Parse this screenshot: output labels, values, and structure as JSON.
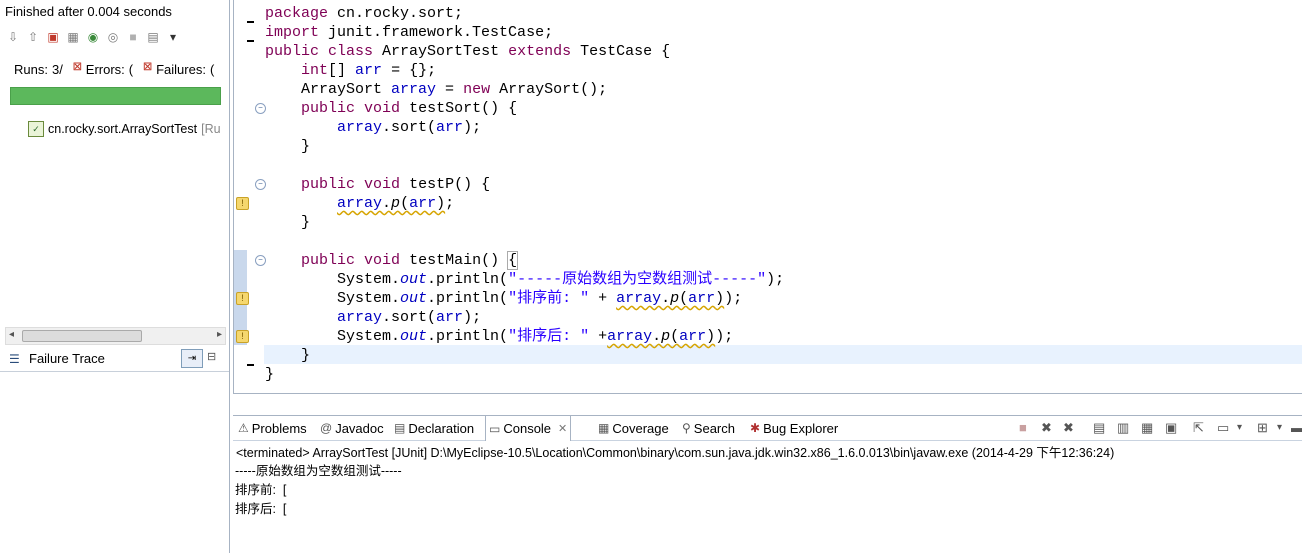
{
  "junit": {
    "status": "Finished after 0.004 seconds",
    "runs_label": "Runs:",
    "runs_value": "3/",
    "errors_label": "Errors:",
    "errors_value": "(",
    "failures_label": "Failures:",
    "failures_value": "(",
    "progress_fraction": 1.0,
    "progress_color": "#5cb85c",
    "tree_item": "cn.rocky.sort.ArraySortTest",
    "tree_item_suffix": "[Ru",
    "failure_trace_label": "Failure Trace"
  },
  "editor": {
    "lines": [
      "package cn.rocky.sort;",
      "import junit.framework.TestCase;",
      "public class ArraySortTest extends TestCase {",
      "    int[] arr = {};",
      "    ArraySort array = new ArraySort();",
      "    public void testSort() {",
      "        array.sort(arr);",
      "    }",
      "",
      "    public void testP() {",
      "        array.p(arr);",
      "    }",
      "",
      "    public void testMain() {",
      "        System.out.println(\"-----原始数组为空数组测试-----\");",
      "        System.out.println(\"排序前: \" + array.p(arr));",
      "        array.sort(arr);",
      "        System.out.println(\"排序后: \" +array.p(arr));",
      "    }",
      "}"
    ]
  },
  "bottom": {
    "tabs": [
      {
        "label": "Problems",
        "icon": "problems-icon"
      },
      {
        "label": "Javadoc",
        "icon": "javadoc-icon"
      },
      {
        "label": "Declaration",
        "icon": "declaration-icon"
      },
      {
        "label": "Console",
        "icon": "console-icon",
        "active": true
      },
      {
        "label": "Coverage",
        "icon": "coverage-icon"
      },
      {
        "label": "Search",
        "icon": "search-icon"
      },
      {
        "label": "Bug Explorer",
        "icon": "bug-icon"
      }
    ],
    "console_info": "<terminated> ArraySortTest [JUnit] D:\\MyEclipse-10.5\\Location\\Common\\binary\\com.sun.java.jdk.win32.x86_1.6.0.013\\bin\\javaw.exe (2014-4-29 下午12:36:24)",
    "console_lines": [
      "-----原始数组为空数组测试-----",
      "排序前:  [",
      "排序后:  ["
    ]
  }
}
